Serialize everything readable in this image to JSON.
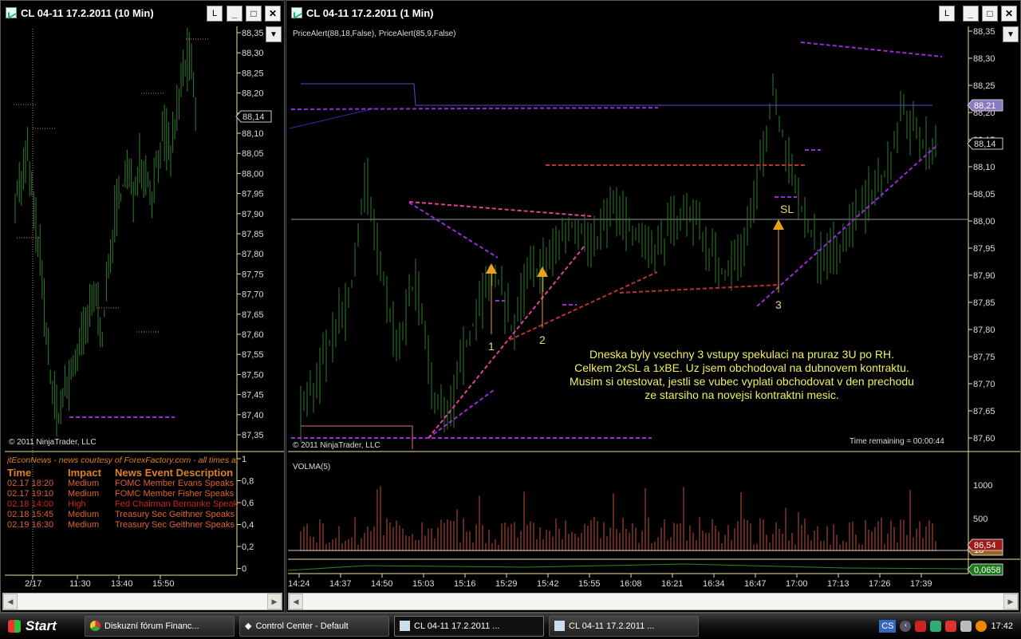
{
  "left_window": {
    "title": "CL 04-11  17.2.2011 (10 Min)",
    "l_button": "L",
    "price_labels": [
      "88,35",
      "88,30",
      "88,25",
      "88,20",
      "88,15",
      "88,10",
      "88,05",
      "88,00",
      "87,95",
      "87,90",
      "87,85",
      "87,80",
      "87,75",
      "87,70",
      "87,65",
      "87,60",
      "87,55",
      "87,50",
      "87,45",
      "87,40",
      "87,35"
    ],
    "current_price": "88,14",
    "copyright": "© 2011 NinjaTrader, LLC",
    "news_axis": [
      "1",
      "0,8",
      "0,6",
      "0,4",
      "0,2",
      "0"
    ],
    "time_labels": [
      "2/17",
      "11:30",
      "13:40",
      "15:50"
    ],
    "news": {
      "source": "jtEconNews - news courtesy of ForexFactory.com - all times are",
      "headers": [
        "Time",
        "Impact",
        "News Event Description"
      ],
      "rows": [
        {
          "time": "02.17 18:20",
          "impact": "Medium",
          "event": "FOMC Member Evans Speaks"
        },
        {
          "time": "02.17 19:10",
          "impact": "Medium",
          "event": "FOMC Member Fisher Speaks"
        },
        {
          "time": "02.18 14:00",
          "impact": "High",
          "event": "Fed Chairman Bernanke Speaks"
        },
        {
          "time": "02.18 15:45",
          "impact": "Medium",
          "event": "Treasury Sec Geithner Speaks"
        },
        {
          "time": "02.19 16:30",
          "impact": "Medium",
          "event": "Treasury Sec Geithner Speaks"
        }
      ]
    }
  },
  "right_window": {
    "title": "CL 04-11  17.2.2011 (1 Min)",
    "l_button": "L",
    "indicator_label": "PriceAlert(88,18,False), PriceAlert(85,9,False)",
    "price_labels": [
      "88,35",
      "88,30",
      "88,25",
      "88,20",
      "88,15",
      "88,10",
      "88,05",
      "88,00",
      "87,95",
      "87,90",
      "87,85",
      "87,80",
      "87,75",
      "87,70",
      "87,65",
      "87,60"
    ],
    "alert_price": "88,21",
    "current_price": "88,14",
    "copyright": "© 2011 NinjaTrader, LLC",
    "time_remaining": "Time remaining = 00:00:44",
    "annotations": {
      "entry1": "1",
      "entry2": "2",
      "entry3": "3",
      "sl": "SL"
    },
    "note": [
      "Dneska byly vsechny 3 vstupy spekulaci na pruraz 3U po RH.",
      "Celkem 2xSL a 1xBE. Uz jsem obchodoval na dubnovem kontraktu.",
      "Musim si otestovat, jestli se vubec vyplati obchodovat v den prechodu",
      "ze starsiho na novejsi kontraktni mesic."
    ],
    "volume": {
      "label": "VOLMA(5)",
      "axis": [
        "1000",
        "500"
      ],
      "ma_value": "86,54",
      "small_value": "18",
      "indicator_value": "0,0658"
    },
    "time_labels": [
      "14:24",
      "14:37",
      "14:50",
      "15:03",
      "15:16",
      "15:29",
      "15:42",
      "15:55",
      "16:08",
      "16:21",
      "16:34",
      "16:47",
      "17:00",
      "17:13",
      "17:26",
      "17:39"
    ]
  },
  "taskbar": {
    "start": "Start",
    "tasks": [
      "Diskuzní fórum Financ...",
      "Control Center - Default",
      "CL 04-11  17.2.2011 ...",
      "CL 04-11  17.2.2011 ..."
    ],
    "lang": "CS",
    "clock": "17:42"
  },
  "colors": {
    "bars": "#2e7d2e",
    "dashed_purple": "#9a2ad8",
    "dashed_pink": "#e0409a",
    "dashed_red": "#c03030",
    "note": "#f0f060",
    "arrow": "#e8a020"
  }
}
